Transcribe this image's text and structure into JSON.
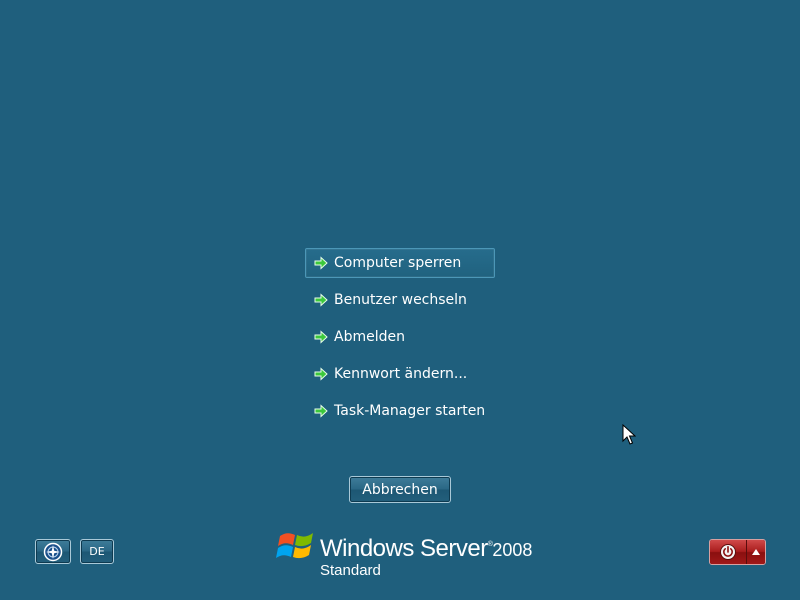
{
  "menu": {
    "items": [
      {
        "label": "Computer sperren",
        "selected": true
      },
      {
        "label": "Benutzer wechseln",
        "selected": false
      },
      {
        "label": "Abmelden",
        "selected": false
      },
      {
        "label": "Kennwort ändern...",
        "selected": false
      },
      {
        "label": "Task-Manager starten",
        "selected": false
      }
    ],
    "icon": "green-arrow-icon"
  },
  "cancel_label": "Abbrechen",
  "language_label": "DE",
  "brand": {
    "product": "Windows Server",
    "registered": "®",
    "year": "2008",
    "edition": "Standard"
  },
  "icons": {
    "ease_of_access": "ease-of-access-icon",
    "power": "power-icon",
    "power_options": "triangle-up-icon"
  },
  "colors": {
    "background": "#1f5f7d",
    "arrow": "#3cc83c",
    "power": "#a91d1d"
  }
}
